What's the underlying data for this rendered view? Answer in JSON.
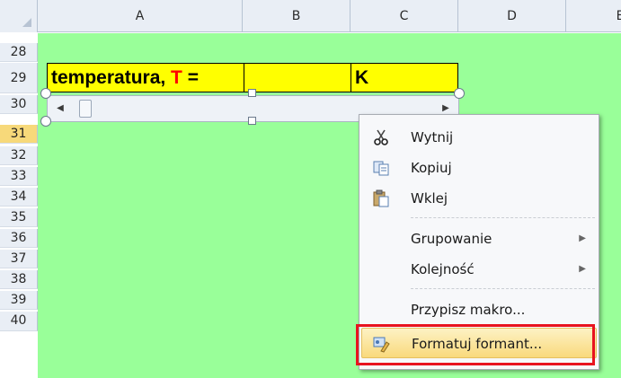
{
  "columns": [
    "A",
    "B",
    "C",
    "D",
    "E"
  ],
  "rows": [
    "28",
    "29",
    "30",
    "31",
    "32",
    "33",
    "34",
    "35",
    "36",
    "37",
    "38",
    "39",
    "40"
  ],
  "active_row": "31",
  "cells": {
    "a29_label": "temperatura, ",
    "a29_var": "T",
    "a29_eq": " =",
    "c29_unit": "K"
  },
  "colors": {
    "sheet_background": "#99ff99",
    "cell_fill": "#ffff00",
    "variable_text": "#ff0000",
    "highlight_border": "#e8131f"
  },
  "context_menu": {
    "items": [
      {
        "label": "Wytnij",
        "icon": "scissors-icon"
      },
      {
        "label": "Kopiuj",
        "icon": "copy-icon"
      },
      {
        "label": "Wklej",
        "icon": "paste-icon"
      },
      {
        "label": "Grupowanie",
        "submenu": true
      },
      {
        "label": "Kolejność",
        "submenu": true
      },
      {
        "label": "Przypisz makro..."
      },
      {
        "label": "Formatuj formant...",
        "icon": "format-control-icon",
        "highlighted": true
      }
    ]
  }
}
